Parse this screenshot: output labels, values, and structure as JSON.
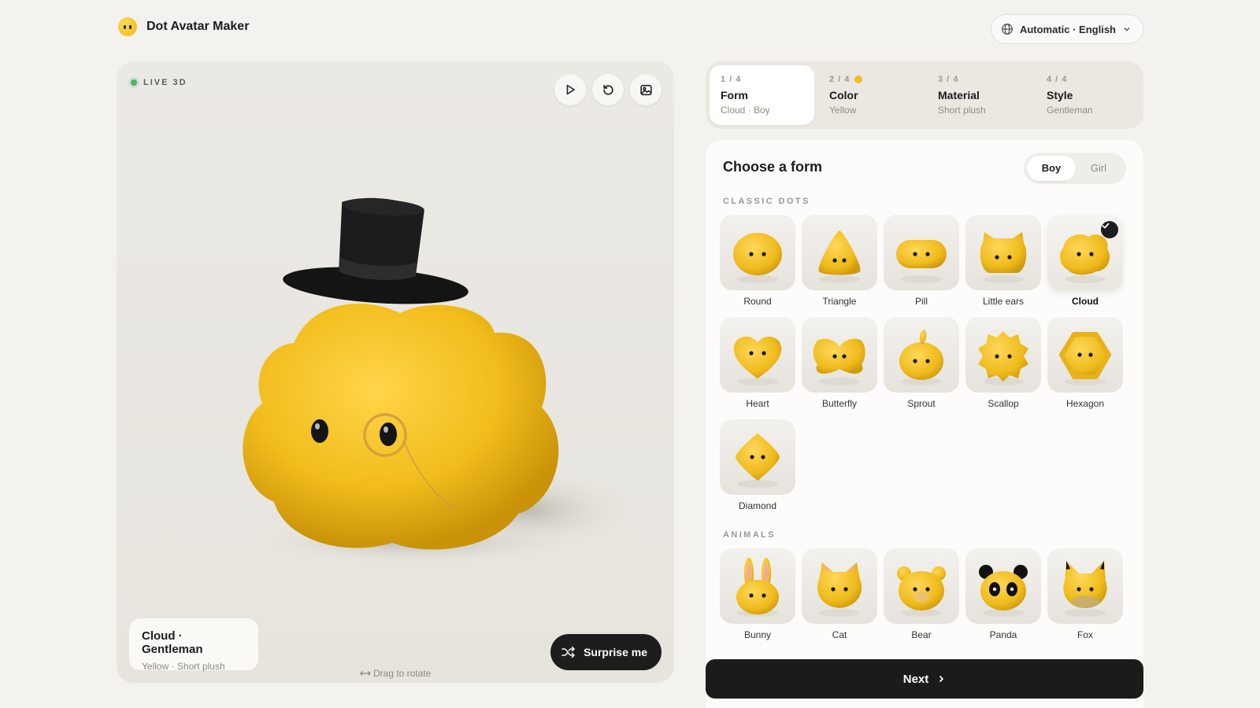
{
  "app": {
    "title": "Dot Avatar Maker",
    "logo_icon": "face-dot-icon"
  },
  "language": {
    "label": "Automatic · English",
    "icon": "globe-icon"
  },
  "viewer": {
    "live_label": "LIVE 3D",
    "drag_hint": "Drag to rotate",
    "caption_title": "Cloud · Gentleman",
    "caption_sub": "Yellow · Short plush",
    "surprise_label": "Surprise me",
    "tools": [
      "play-icon",
      "reset-icon",
      "image-icon"
    ]
  },
  "steps": [
    {
      "num": "1 / 4",
      "title": "Form",
      "sub": "Cloud · Boy",
      "active": true
    },
    {
      "num": "2 / 4",
      "title": "Color",
      "sub": "Yellow",
      "swatch": "#f0bf20"
    },
    {
      "num": "3 / 4",
      "title": "Material",
      "sub": "Short plush"
    },
    {
      "num": "4 / 4",
      "title": "Style",
      "sub": "Gentleman"
    }
  ],
  "form": {
    "title": "Choose a form",
    "gender": {
      "options": [
        "Boy",
        "Girl"
      ],
      "selected": "Boy"
    },
    "classic_label": "CLASSIC DOTS",
    "classic": [
      "Round",
      "Triangle",
      "Pill",
      "Little ears",
      "Cloud",
      "Heart",
      "Butterfly",
      "Sprout",
      "Scallop",
      "Hexagon",
      "Diamond"
    ],
    "selected": "Cloud",
    "animals_label": "ANIMALS",
    "animals": [
      "Bunny",
      "Cat",
      "Bear",
      "Panda",
      "Fox"
    ]
  },
  "next_label": "Next",
  "colors": {
    "plush": "#f0bf20",
    "dark": "#1d1d1d",
    "live": "#4fb26a"
  }
}
